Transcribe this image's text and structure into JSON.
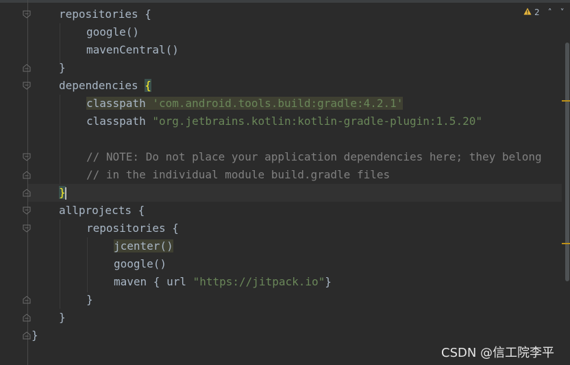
{
  "editor": {
    "inspection": {
      "warning_icon": "warning-triangle-icon",
      "warning_color": "#e8b73c",
      "warning_count": "2",
      "prev_label": "˄",
      "next_label": "˅"
    },
    "lines": [
      {
        "id": "l1",
        "parts": [
          "repositories {"
        ]
      },
      {
        "id": "l2",
        "parts": [
          "google()"
        ]
      },
      {
        "id": "l3",
        "parts": [
          "mavenCentral()"
        ]
      },
      {
        "id": "l4",
        "parts": [
          "}"
        ]
      },
      {
        "id": "l5",
        "parts": [
          "dependencies ",
          "{"
        ]
      },
      {
        "id": "l6",
        "parts": [
          "classpath",
          " ",
          "'com.android.tools.build:gradle:4.2.1'"
        ]
      },
      {
        "id": "l7",
        "parts": [
          "classpath ",
          "\"org.jetbrains.kotlin:kotlin-gradle-plugin:1.5.20\""
        ]
      },
      {
        "id": "l8",
        "parts": [
          ""
        ]
      },
      {
        "id": "l9",
        "parts": [
          "// NOTE: Do not place your application dependencies here; they belong"
        ]
      },
      {
        "id": "l10",
        "parts": [
          "// in the individual module build.gradle files"
        ]
      },
      {
        "id": "l11",
        "parts": [
          "}"
        ]
      },
      {
        "id": "l12",
        "parts": [
          "allprojects {"
        ]
      },
      {
        "id": "l13",
        "parts": [
          "repositories {"
        ]
      },
      {
        "id": "l14",
        "parts": [
          "jcenter()"
        ]
      },
      {
        "id": "l15",
        "parts": [
          "google()"
        ]
      },
      {
        "id": "l16",
        "parts": [
          "maven { url ",
          "\"https://jitpack.io\"",
          "}"
        ]
      },
      {
        "id": "l17",
        "parts": [
          "}"
        ]
      },
      {
        "id": "l18",
        "parts": [
          "}"
        ]
      },
      {
        "id": "l19",
        "parts": [
          "}"
        ]
      }
    ]
  },
  "watermark": "CSDN @信工院李平"
}
